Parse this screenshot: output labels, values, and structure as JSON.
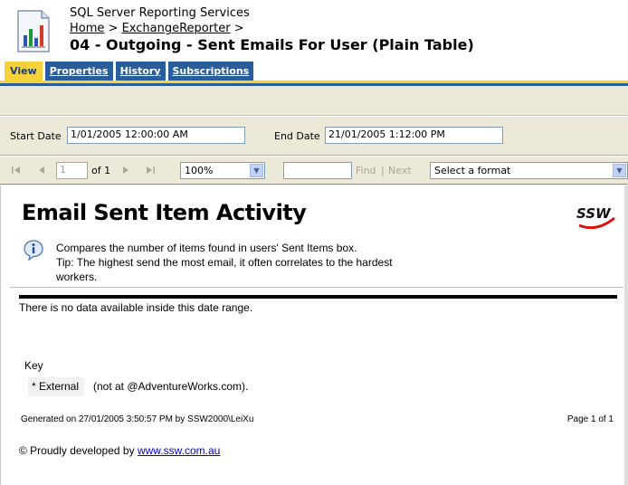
{
  "header": {
    "app_title": "SQL Server Reporting Services",
    "breadcrumb": {
      "home": "Home",
      "sep1": ">",
      "folder": "ExchangeReporter",
      "sep2": ">"
    },
    "page_title": "04 - Outgoing - Sent Emails For User (Plain Table)"
  },
  "tabs": [
    {
      "label": "View",
      "active": true
    },
    {
      "label": "Properties",
      "active": false
    },
    {
      "label": "History",
      "active": false
    },
    {
      "label": "Subscriptions",
      "active": false
    }
  ],
  "parameters": {
    "start_label": "Start Date",
    "start_value": "1/01/2005 12:00:00 AM",
    "end_label": "End Date",
    "end_value": "21/01/2005 1:12:00 PM"
  },
  "nav": {
    "page_value": "1",
    "of_label": "of 1",
    "zoom_value": "100%",
    "find_label": "Find",
    "find_sep": "|",
    "next_label": "Next",
    "format_value": "Select a format"
  },
  "report": {
    "title": "Email Sent Item Activity",
    "description_line1": "Compares the number of items found in users' Sent Items box.",
    "description_line2": "Tip: The highest send the most email, it often correlates to the hardest",
    "description_line3": "workers.",
    "no_data": "There is no data available inside this date range.",
    "key_label": "Key",
    "key_external": "* External",
    "key_note": "(not at @AdventureWorks.com).",
    "generated": "Generated on 27/01/2005 3:50:57 PM by SSW2000\\LeiXu",
    "page_count": "Page 1 of 1",
    "footer_text": "© Proudly developed by",
    "footer_link": "www.ssw.com.au",
    "logo_text": "SSW"
  },
  "colors": {
    "tab_blue": "#2a5d9b",
    "tab_yellow": "#f7d13a",
    "toolbar_bg": "#ece9d8",
    "link_blue": "#0000cc"
  }
}
